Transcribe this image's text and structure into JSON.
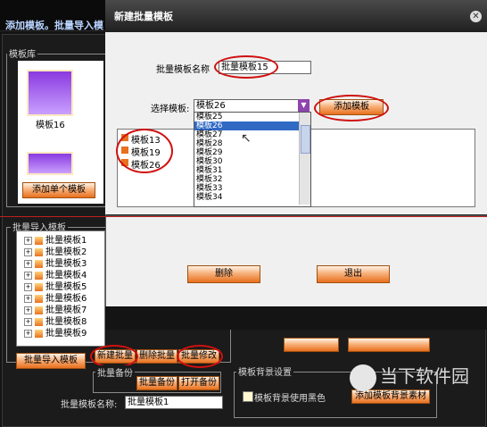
{
  "background_window": {
    "title": "添加模板。批量导入模",
    "template_library_label": "模板库",
    "thumb_caption": "模板16",
    "add_single_button": "添加单个模板",
    "batch_import_label": "批量导入模板",
    "tree_items": [
      "批量模板1",
      "批量模板2",
      "批量模板3",
      "批量模板4",
      "批量模板5",
      "批量模板6",
      "批量模板7",
      "批量模板8",
      "批量模板9"
    ],
    "batch_import_button": "批量导入模板",
    "new_batch_button": "新建批量",
    "delete_batch_button": "删除批量",
    "modify_batch_button": "批量修改",
    "batch_backup_label": "批量备份",
    "batch_backup_button": "批量备份",
    "open_backup_button": "打开备份",
    "batch_name_label": "批量模板名称:",
    "batch_name_value": "批量模板1",
    "bg_settings_label": "模板背景设置",
    "bg_checkbox_label": "模板背景使用黑色",
    "add_bg_button": "添加模板背景素材"
  },
  "dialog": {
    "title": "新建批量模板",
    "name_label": "批量模板名称",
    "name_value": "批量模板15",
    "select_label": "选择模板:",
    "select_value": "模板26",
    "add_button": "添加模板",
    "dropdown_options": [
      "模板25",
      "模板26",
      "模板27",
      "模板28",
      "模板29",
      "模板30",
      "模板31",
      "模板32",
      "模板33",
      "模板34"
    ],
    "dropdown_selected_index": 1,
    "added_list": [
      "模板13",
      "模板19",
      "模板26"
    ],
    "delete_button": "删除",
    "exit_button": "退出"
  },
  "watermark": "当下软件园",
  "colors": {
    "accent_orange": "#e8701e",
    "highlight_red": "#d01010",
    "selection_blue": "#316ac5"
  }
}
